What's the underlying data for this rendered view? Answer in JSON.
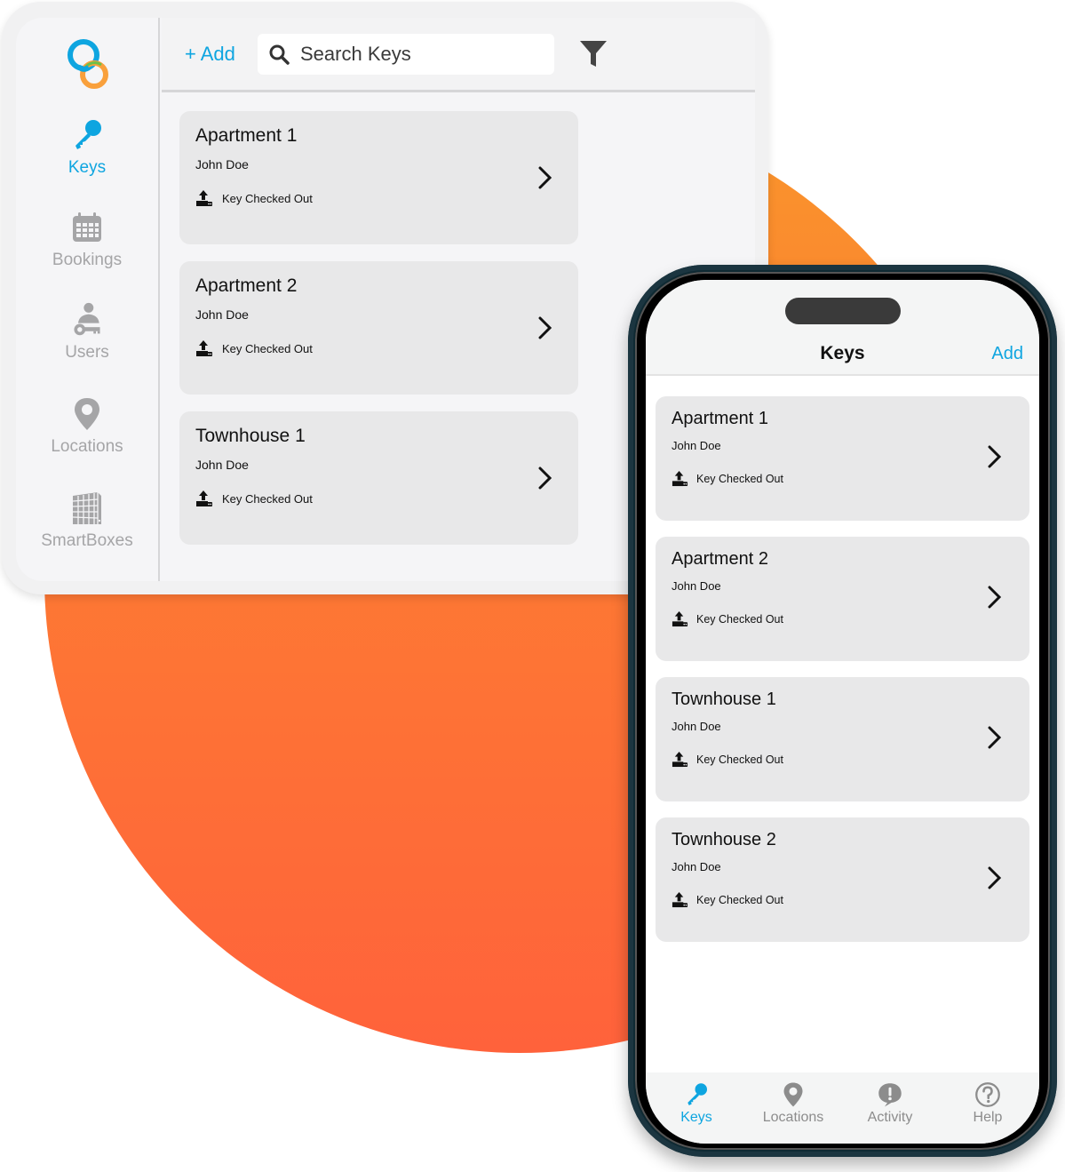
{
  "colors": {
    "accent": "#0ea5e0",
    "inactive": "#a5a5a7",
    "card_bg": "#e8e8e9",
    "blob_top": "#f9962b",
    "blob_bottom": "#ff623b"
  },
  "desktop": {
    "sidebar": {
      "items": [
        {
          "label": "Keys",
          "icon": "key-icon",
          "active": true
        },
        {
          "label": "Bookings",
          "icon": "calendar-icon",
          "active": false
        },
        {
          "label": "Users",
          "icon": "user-key-icon",
          "active": false
        },
        {
          "label": "Locations",
          "icon": "location-pin-icon",
          "active": false
        },
        {
          "label": "SmartBoxes",
          "icon": "smartbox-icon",
          "active": false
        }
      ]
    },
    "toolbar": {
      "add_label": "+ Add",
      "search_placeholder": "Search Keys",
      "filter_icon": "filter-icon"
    },
    "keys": [
      {
        "title": "Apartment 1",
        "user": "John Doe",
        "status": "Key Checked Out"
      },
      {
        "title": "Apartment 2",
        "user": "John Doe",
        "status": "Key Checked Out"
      },
      {
        "title": "Townhouse 1",
        "user": "John Doe",
        "status": "Key Checked Out"
      }
    ]
  },
  "mobile": {
    "header": {
      "title": "Keys",
      "add_label": "Add"
    },
    "keys": [
      {
        "title": "Apartment 1",
        "user": "John Doe",
        "status": "Key Checked Out"
      },
      {
        "title": "Apartment 2",
        "user": "John Doe",
        "status": "Key Checked Out"
      },
      {
        "title": "Townhouse 1",
        "user": "John Doe",
        "status": "Key Checked Out"
      },
      {
        "title": "Townhouse 2",
        "user": "John Doe",
        "status": "Key Checked Out"
      }
    ],
    "tabbar": [
      {
        "label": "Keys",
        "icon": "key-icon",
        "active": true
      },
      {
        "label": "Locations",
        "icon": "location-pin-icon",
        "active": false
      },
      {
        "label": "Activity",
        "icon": "alert-bubble-icon",
        "active": false
      },
      {
        "label": "Help",
        "icon": "help-circle-icon",
        "active": false
      }
    ]
  }
}
